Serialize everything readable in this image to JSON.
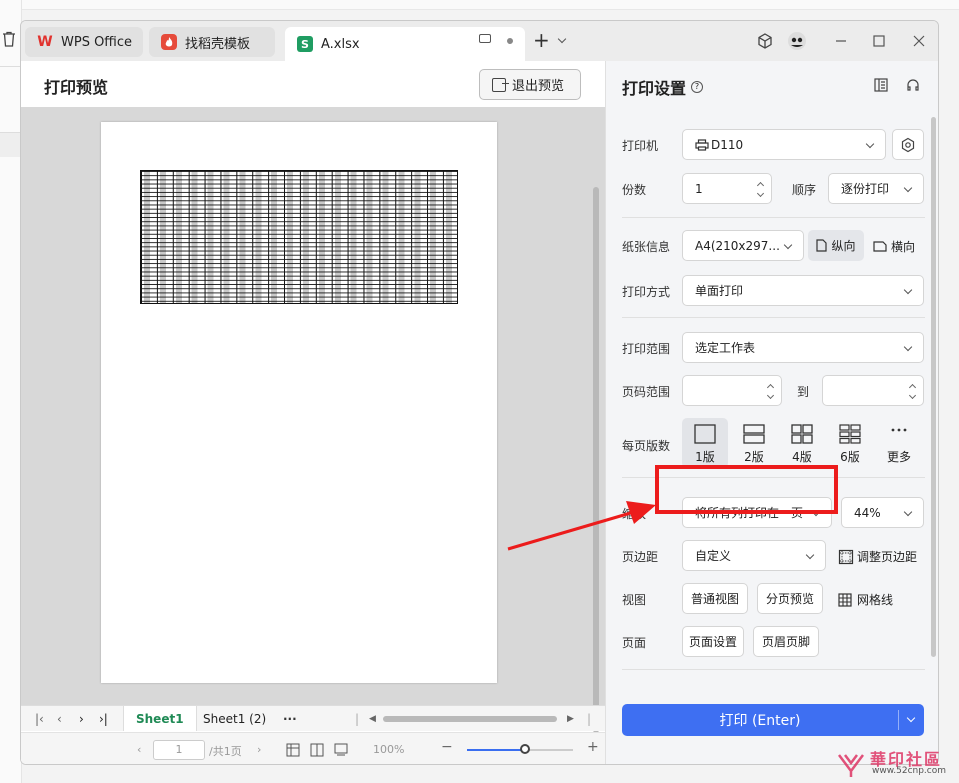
{
  "tabs": [
    {
      "label": "WPS Office",
      "icon": "wps-logo-icon"
    },
    {
      "label": "找稻壳模板",
      "icon": "daoke-logo-icon"
    },
    {
      "label": "A.xlsx",
      "icon": "spreadsheet-icon",
      "icon_text": "S"
    }
  ],
  "preview": {
    "title": "打印预览",
    "exit_label": "退出预览"
  },
  "sheets": [
    {
      "label": "Sheet1",
      "active": true
    },
    {
      "label": "Sheet1 (2)",
      "active": false
    }
  ],
  "status": {
    "page_input": "1",
    "page_total": "/共1页",
    "zoom": "100%",
    "zoom_level": 0.55
  },
  "settings": {
    "title": "打印设置",
    "printer_label": "打印机",
    "printer_value": "D110",
    "copies_label": "份数",
    "copies_value": "1",
    "order_label": "顺序",
    "order_value": "逐份打印",
    "paper_label": "纸张信息",
    "paper_value": "A4(210x297...",
    "portrait_label": "纵向",
    "landscape_label": "横向",
    "mode_label": "打印方式",
    "mode_value": "单面打印",
    "range_label": "打印范围",
    "range_value": "选定工作表",
    "pages_label": "页码范围",
    "pages_to": "到",
    "per_page_label": "每页版数",
    "layouts": [
      "1版",
      "2版",
      "4版",
      "6版",
      "更多"
    ],
    "scale_label": "缩放",
    "scale_value": "将所有列打印在一页",
    "scale_percent": "44%",
    "margin_label": "页边距",
    "margin_value": "自定义",
    "adjust_margin_label": "调整页边距",
    "view_label": "视图",
    "normal_view_label": "普通视图",
    "page_break_label": "分页预览",
    "gridlines_label": "网格线",
    "page_label": "页面",
    "page_setup_label": "页面设置",
    "header_footer_label": "页眉页脚",
    "print_button_label": "打印 (Enter)"
  },
  "watermark": {
    "text": "華印社區",
    "url": "www.52cnp.com"
  },
  "colors": {
    "accent": "#3e6ff2",
    "sheet_active": "#1f8a55",
    "highlight": "#ec1c1c"
  }
}
